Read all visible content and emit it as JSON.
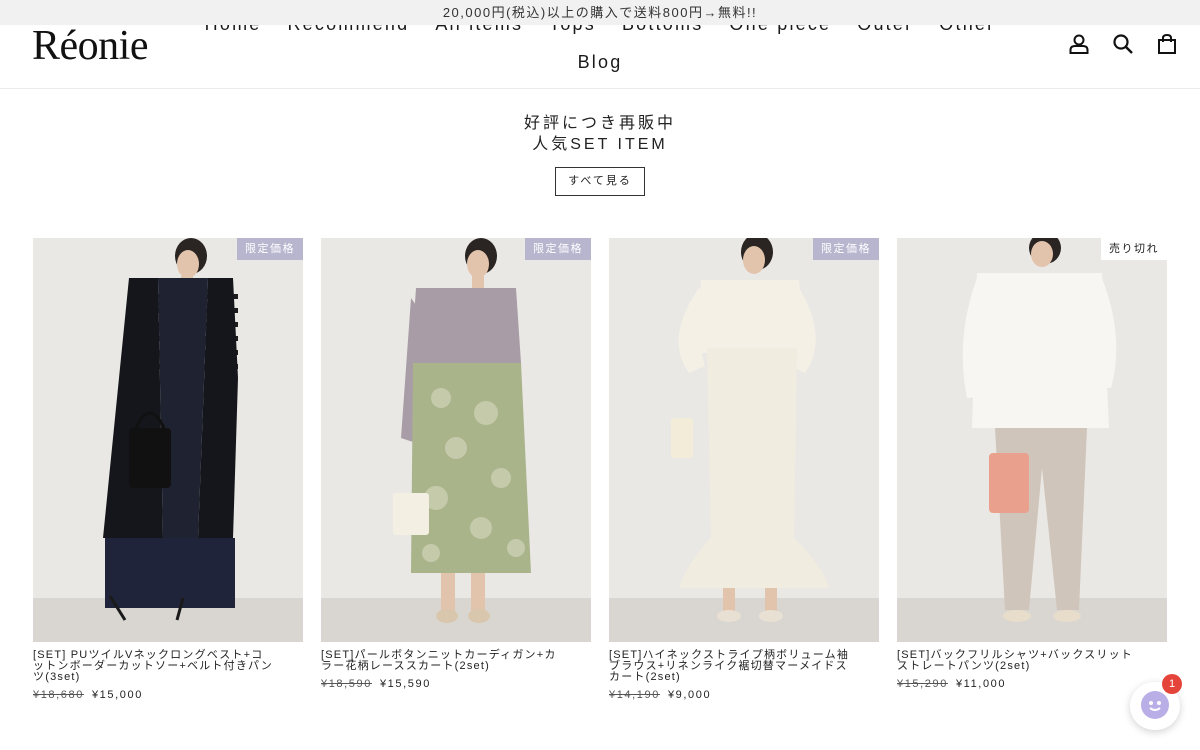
{
  "announcement": "20,000円(税込)以上の購入で送料800円→無料!!",
  "brand": {
    "logo": "Réonie"
  },
  "nav": {
    "row1": [
      "Home",
      "Recommend",
      "All items",
      "Tops",
      "Bottoms",
      "One piece",
      "Outer",
      "Other"
    ],
    "row2": "Blog"
  },
  "header_icons": [
    "account-icon",
    "search-icon",
    "cart-icon"
  ],
  "section": {
    "line1": "好評につき再販中",
    "line2": "人気SET ITEM",
    "view_all": "すべて見る"
  },
  "products": [
    {
      "badge": "限定価格",
      "name_lines": [
        "[SET] PUツイルVネックロングベスト+コ",
        "ットンボーダーカットソー+ベルト付きパン",
        "ツ(3set)"
      ],
      "old_price": "¥18,680",
      "price": "¥15,000"
    },
    {
      "badge": "限定価格",
      "name_lines": [
        "[SET]パールボタンニットカーディガン+カ",
        "ラー花柄レーススカート(2set)"
      ],
      "old_price": "¥18,590",
      "price": "¥15,590"
    },
    {
      "badge": "限定価格",
      "name_lines": [
        "[SET]ハイネックストライプ柄ボリューム袖",
        "ブラウス+リネンライク裾切替マーメイドス",
        "カート(2set)"
      ],
      "old_price": "¥14,190",
      "price": "¥9,000"
    },
    {
      "badge": "売り切れ",
      "name_lines": [
        "[SET]バックフリルシャツ+バックスリット",
        "ストレートパンツ(2set)"
      ],
      "old_price": "¥15,290",
      "price": "¥11,000"
    }
  ],
  "chat": {
    "unread": "1"
  },
  "colors": {
    "badge_sale": "#b8b5cf",
    "badge_soldout": "#ffffff",
    "chat_badge": "#e4443a"
  }
}
